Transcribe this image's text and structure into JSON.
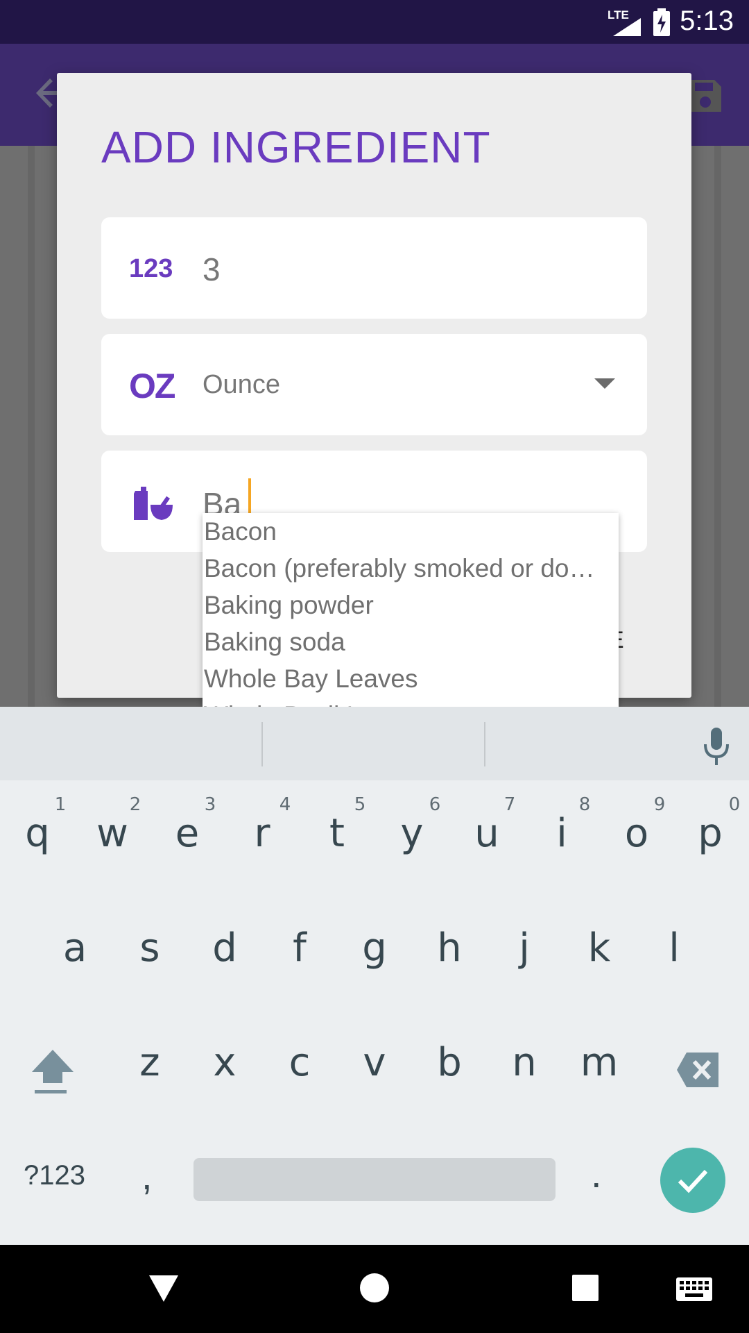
{
  "status_bar": {
    "time": "5:13",
    "network": "LTE",
    "icons": [
      "lte-signal-icon",
      "battery-charging-icon"
    ]
  },
  "dialog": {
    "title": "ADD INGREDIENT",
    "quantity": {
      "icon_label": "123",
      "value": "3"
    },
    "unit": {
      "icon_label": "OZ",
      "value": "Ounce"
    },
    "ingredient": {
      "icon": "mortar-bottle-icon",
      "value": "Ba"
    },
    "button_fragment": "E"
  },
  "suggestions": [
    "Bacon",
    "Bacon (preferably smoked or do…",
    "Baking powder",
    "Baking soda",
    "Whole Bay Leaves",
    "Whole Basil Leaves"
  ],
  "keyboard": {
    "row1": [
      "q",
      "w",
      "e",
      "r",
      "t",
      "y",
      "u",
      "i",
      "o",
      "p"
    ],
    "row1_hints": [
      "1",
      "2",
      "3",
      "4",
      "5",
      "6",
      "7",
      "8",
      "9",
      "0"
    ],
    "row2": [
      "a",
      "s",
      "d",
      "f",
      "g",
      "h",
      "j",
      "k",
      "l"
    ],
    "row3": [
      "z",
      "x",
      "c",
      "v",
      "b",
      "n",
      "m"
    ],
    "symbols_label": "?123",
    "comma": ",",
    "period": "."
  },
  "colors": {
    "accent": "#6a3bbf",
    "status_bar": "#211546",
    "app_bar": "#3d2a6e",
    "done_key": "#4db6ac",
    "cursor": "#f5a623"
  }
}
